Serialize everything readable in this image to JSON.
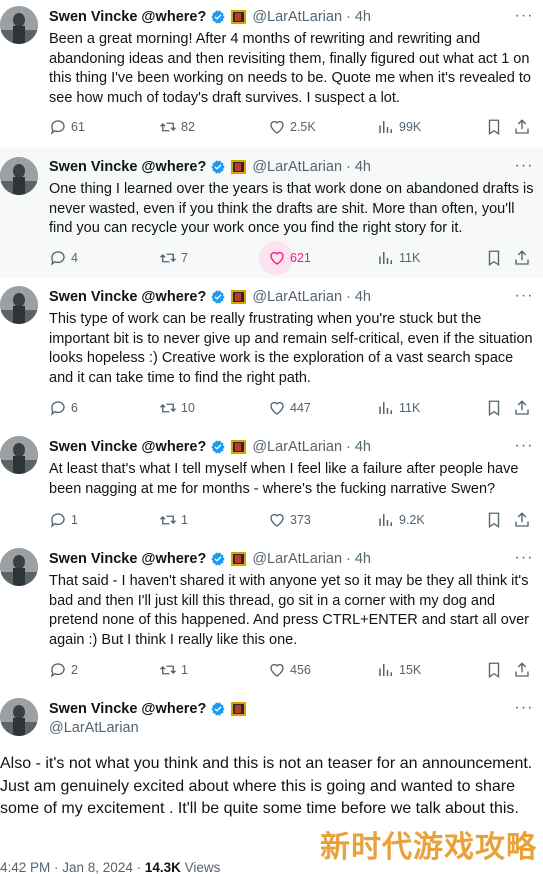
{
  "author": {
    "name": "Swen Vincke @where?",
    "handle": "@LarAtLarian",
    "time": "4h",
    "dot": "·",
    "more": "···"
  },
  "colors": {
    "like_active": "#f91880",
    "verified": "#1d9bf0",
    "muted": "#536471"
  },
  "tweets": [
    {
      "text": "Been a great morning! After 4 months of rewriting and rewriting and abandoning ideas and then revisiting them, finally figured out what act 1 on this thing I've been working on needs to be. Quote me when it's revealed to see how much of today's draft survives. I suspect a lot.",
      "replies": "61",
      "reposts": "82",
      "likes": "2.5K",
      "views": "99K"
    },
    {
      "text": "One thing I learned over the years is that work done on abandoned drafts is never wasted, even if you think the drafts are shit. More than often, you'll find you can recycle your work once you find the right story for it.",
      "replies": "4",
      "reposts": "7",
      "likes": "621",
      "views": "11K"
    },
    {
      "text": "This type of work can be really frustrating when you're stuck but the important bit is to never give up and remain self-critical, even if the situation looks hopeless :) Creative work is the exploration of a vast search space and it can take time to find the right path.",
      "replies": "6",
      "reposts": "10",
      "likes": "447",
      "views": "11K"
    },
    {
      "text": "At least that's what I tell myself when I feel like a failure after people have been nagging at me for months - where's the fucking narrative Swen?",
      "replies": "1",
      "reposts": "1",
      "likes": "373",
      "views": "9.2K"
    },
    {
      "text": "That said - I haven't shared it with anyone yet so it may be they all think it's bad and then I'll just kill this thread, go sit in a corner with my dog and pretend none of this happened. And press CTRL+ENTER and start all over again :) But I think I really like this one.",
      "replies": "2",
      "reposts": "1",
      "likes": "456",
      "views": "15K"
    }
  ],
  "main_tweet": {
    "text": "Also - it's not what you think and this is not an teaser for an announcement. Just am genuinely excited about where this is going and wanted to share some of my excitement . It'll be quite some time before we talk about this.",
    "timestamp": "4:42 PM · Jan 8, 2024 · ",
    "views_count": "14.3K",
    "views_label": " Views"
  },
  "watermark": "新时代游戏攻略"
}
